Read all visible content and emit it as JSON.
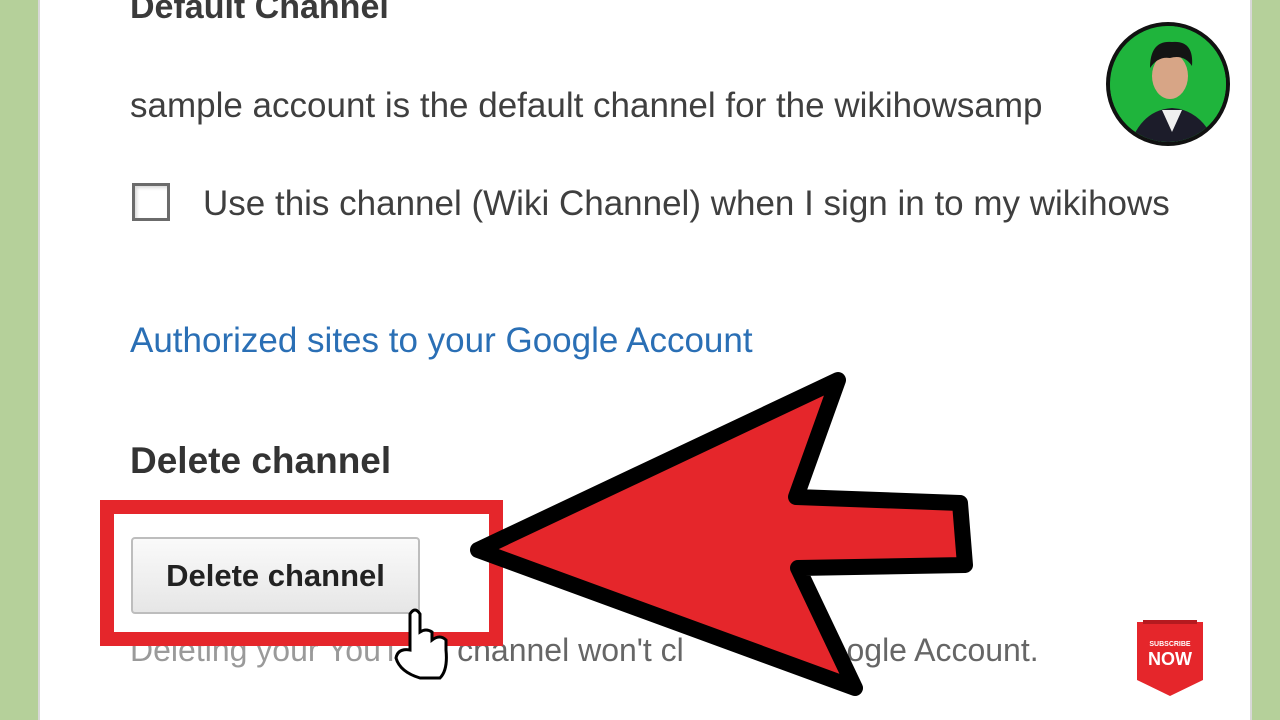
{
  "sections": {
    "default_channel": {
      "heading": "Default Channel",
      "description": "sample account is the default channel for the wikihowsamp",
      "checkbox_label": "Use this channel (Wiki Channel) when I sign in to my wikihows",
      "checked": false
    },
    "authorized_link": "Authorized sites to your Google Account",
    "delete_channel": {
      "heading": "Delete channel",
      "button_label": "Delete channel",
      "note_left": "Deleting your YouT",
      "note_right": "e channel won't cl",
      "note_end": "Google Account."
    }
  },
  "overlay": {
    "arrow_color": "#e5262b",
    "highlight_color": "#e5262b",
    "subscribe_top": "SUBSCRIBE",
    "subscribe_main": "NOW",
    "avatar_ring_color": "#1fb43c"
  }
}
